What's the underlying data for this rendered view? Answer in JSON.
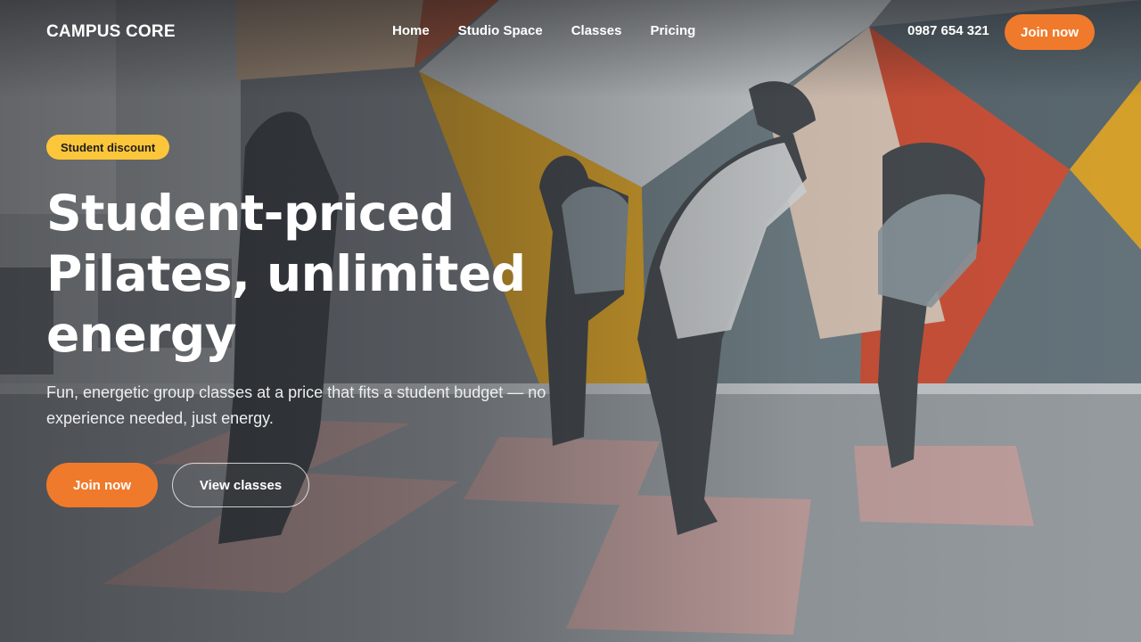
{
  "brand": {
    "name": "CAMPUS CORE"
  },
  "nav": {
    "items": [
      {
        "label": "Home"
      },
      {
        "label": "Studio Space"
      },
      {
        "label": "Classes"
      },
      {
        "label": "Pricing"
      }
    ]
  },
  "header": {
    "phone": "0987 654 321",
    "cta_label": "Join now"
  },
  "hero": {
    "badge": "Student discount",
    "title": "Student-priced Pilates, unlimited energy",
    "subtitle": "Fun, energetic group classes at a price that fits a student budget — no experience needed, just energy.",
    "primary_cta": "Join now",
    "secondary_cta": "View classes",
    "background_image": "pilates-studio-group-stretching-photo"
  },
  "colors": {
    "accent": "#f07a2b",
    "badge": "#fcc63b",
    "text": "#ffffff"
  }
}
